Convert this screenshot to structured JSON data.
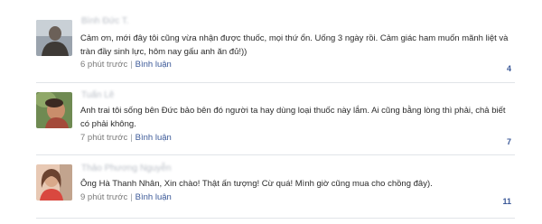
{
  "comments": [
    {
      "author": "Bình Đức T.",
      "text": "Cảm ơn, mới đây tôi cũng vừa nhận được thuốc, mọi thứ ổn. Uống 3 ngày rồi. Cảm giác ham muốn mãnh liệt và tràn đầy sinh lực, hôm nay gấu anh ăn đủ!))",
      "time": "6 phút trước",
      "separator": "|",
      "reply_label": "Bình luận",
      "count": "4"
    },
    {
      "author": "Tuấn Lê",
      "text": "Anh trai tôi sống bên Đức bảo bên đó người ta hay dùng loại thuốc này lắm. Ai cũng bằng lòng thì phải, chả biết có phải không.",
      "time": "7 phút trước",
      "separator": "|",
      "reply_label": "Bình luận",
      "count": "7"
    },
    {
      "author": "Thảo Phương Nguyễn",
      "text": "Ông Hà Thanh Nhân, Xin chào! Thật ấn tượng! Cừ quá! Mình giờ cũng mua cho chồng đây).",
      "time": "9 phút trước",
      "separator": "|",
      "reply_label": "Bình luận",
      "count": "11"
    }
  ]
}
